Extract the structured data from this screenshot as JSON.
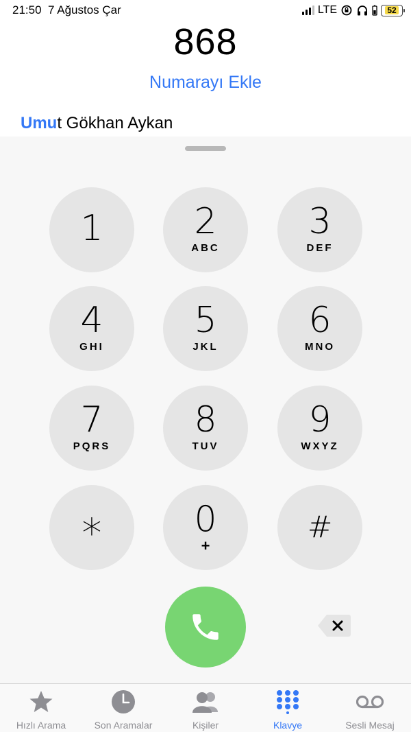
{
  "status": {
    "time": "21:50",
    "date": "7 Ağustos Çar",
    "network": "LTE",
    "battery": "52"
  },
  "dialer": {
    "number": "868",
    "add_number": "Numarayı Ekle",
    "match_highlight": "Umu",
    "match_rest": "t Gökhan Aykan"
  },
  "keys": [
    {
      "digit": "1",
      "letters": ""
    },
    {
      "digit": "2",
      "letters": "ABC"
    },
    {
      "digit": "3",
      "letters": "DEF"
    },
    {
      "digit": "4",
      "letters": "GHI"
    },
    {
      "digit": "5",
      "letters": "JKL"
    },
    {
      "digit": "6",
      "letters": "MNO"
    },
    {
      "digit": "7",
      "letters": "PQRS"
    },
    {
      "digit": "8",
      "letters": "TUV"
    },
    {
      "digit": "9",
      "letters": "WXYZ"
    },
    {
      "digit": "*",
      "letters": ""
    },
    {
      "digit": "0",
      "letters": "+"
    },
    {
      "digit": "#",
      "letters": ""
    }
  ],
  "tabs": [
    {
      "label": "Hızlı Arama",
      "icon": "star-icon"
    },
    {
      "label": "Son Aramalar",
      "icon": "clock-icon"
    },
    {
      "label": "Kişiler",
      "icon": "contacts-icon"
    },
    {
      "label": "Klavye",
      "icon": "keypad-icon",
      "active": true
    },
    {
      "label": "Sesli Mesaj",
      "icon": "voicemail-icon"
    }
  ],
  "colors": {
    "accent": "#3478f6",
    "call": "#78d572",
    "key": "#e5e5e5",
    "tab_inactive": "#8e8e93"
  }
}
